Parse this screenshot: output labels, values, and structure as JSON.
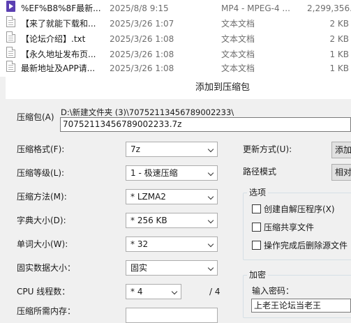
{
  "file_list": [
    {
      "icon": "video-file-icon",
      "name": "%EF%B8%8F最新...",
      "date": "2025/8/8 9:15",
      "type": "MP4 - MPEG-4 ...",
      "size": "2,299,356..."
    },
    {
      "icon": "text-file-icon",
      "name": "【来了就能下载和...",
      "date": "2025/3/26 1:07",
      "type": "文本文档",
      "size": "2 KB"
    },
    {
      "icon": "text-file-icon",
      "name": "【论坛介绍】.txt",
      "date": "2025/3/26 1:08",
      "type": "文本文档",
      "size": "2 KB"
    },
    {
      "icon": "text-file-icon",
      "name": "【永久地址发布页...",
      "date": "2025/3/26 1:08",
      "type": "文本文档",
      "size": "1 KB"
    },
    {
      "icon": "text-file-icon",
      "name": "最新地址及APP请...",
      "date": "2025/3/26 1:08",
      "type": "文本文档",
      "size": "1 KB"
    }
  ],
  "dialog": {
    "title": "添加到压缩包",
    "archive_label": "压缩包(A)",
    "archive_dir": "D:\\新建文件夹 (3)\\70752113456789002233\\",
    "archive_name": "70752113456789002233.7z",
    "fields": {
      "format": {
        "label": "压缩格式(F):",
        "value": "7z"
      },
      "level": {
        "label": "压缩等级(L):",
        "value": "1 - 极速压缩"
      },
      "method": {
        "label": "压缩方法(M):",
        "value": "* LZMA2"
      },
      "dict": {
        "label": "字典大小(D):",
        "value": "* 256 KB"
      },
      "word": {
        "label": "单词大小(W):",
        "value": "* 32"
      },
      "solid": {
        "label": "固实数据大小：",
        "value": "固实"
      },
      "threads": {
        "label": "CPU 线程数：",
        "value": "* 4",
        "total": "/ 4"
      },
      "memory": {
        "label": "压缩所需内存："
      }
    },
    "update_label": "更新方式(U):",
    "update_value": "添加",
    "pathmode_label": "路径模式",
    "pathmode_value": "相对",
    "options": {
      "title": "选项",
      "items": [
        "创建自解压程序(X)",
        "压缩共享文件",
        "操作完成后删除源文件"
      ]
    },
    "encryption": {
      "title": "加密",
      "password_label": "输入密码：",
      "password_value": "上老王论坛当老王"
    }
  }
}
